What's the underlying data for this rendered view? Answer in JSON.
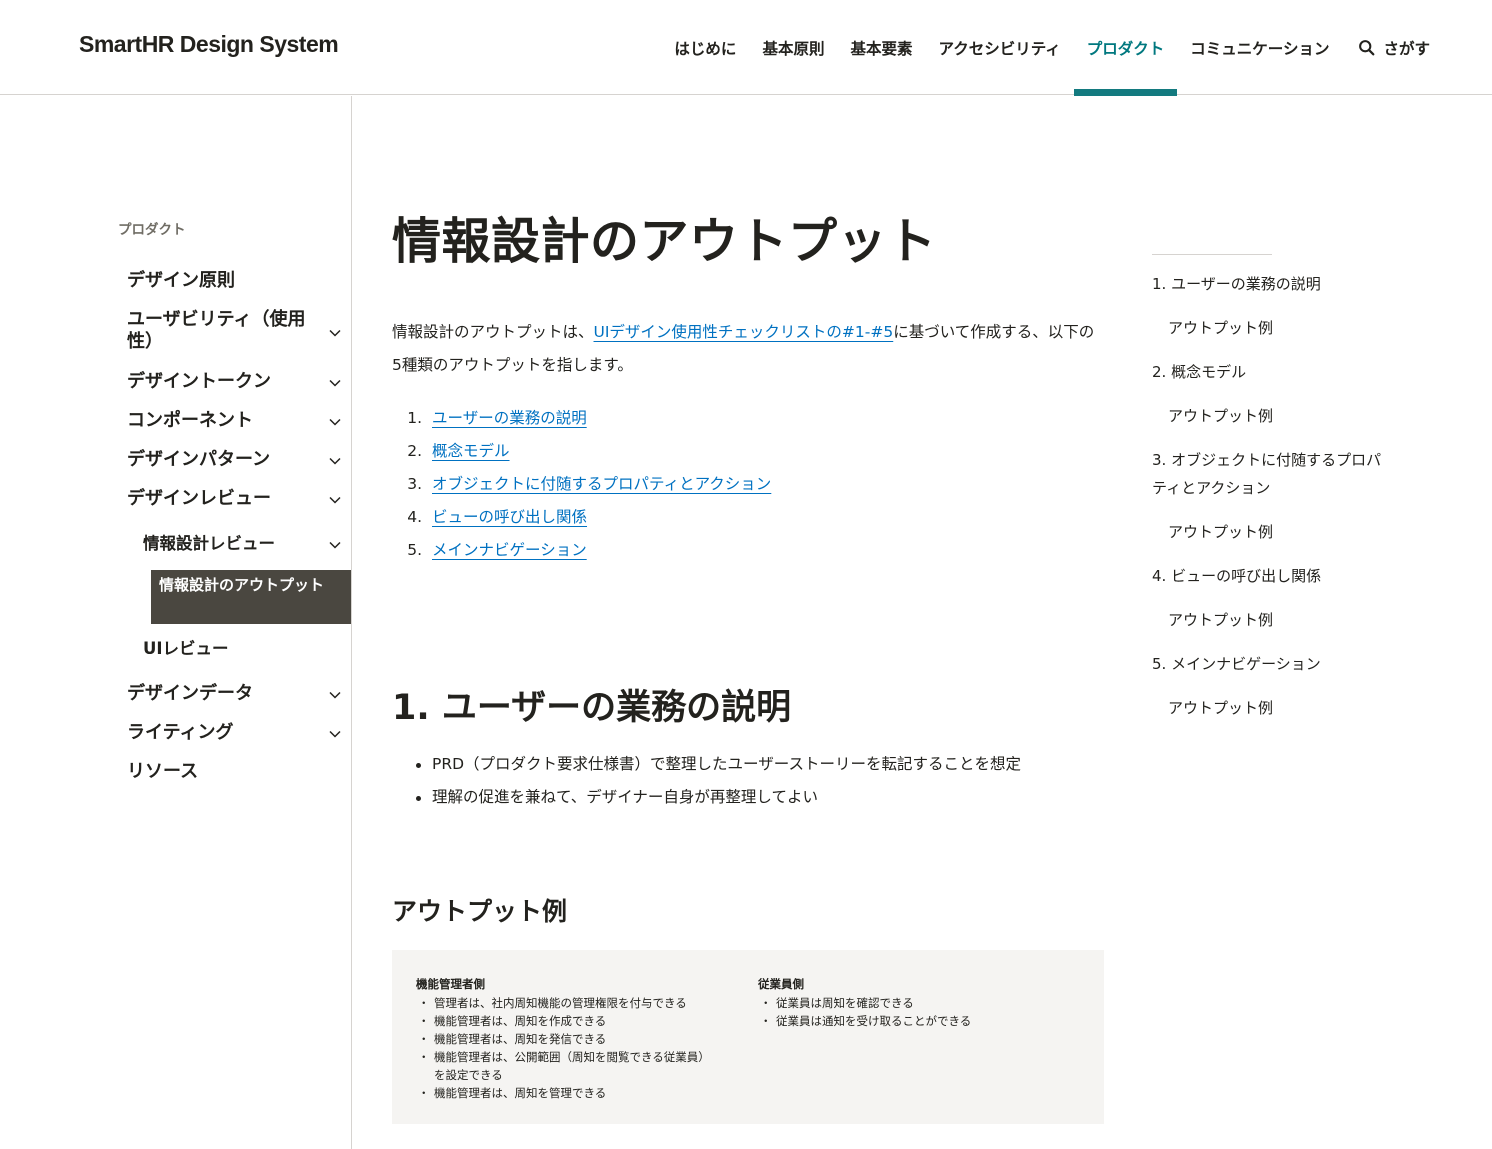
{
  "header": {
    "logo": "SmartHR Design System",
    "nav": [
      {
        "label": "はじめに"
      },
      {
        "label": "基本原則"
      },
      {
        "label": "基本要素"
      },
      {
        "label": "アクセシビリティ"
      },
      {
        "label": "プロダクト",
        "active": true
      },
      {
        "label": "コミュニケーション"
      }
    ],
    "search_label": "さがす"
  },
  "sidebar": {
    "category": "プロダクト",
    "items": [
      {
        "label": "デザイン原則"
      },
      {
        "label": "ユーザビリティ（使用性）"
      },
      {
        "label": "デザイントークン"
      },
      {
        "label": "コンポーネント"
      },
      {
        "label": "デザインパターン"
      },
      {
        "label": "デザインレビュー"
      },
      {
        "label": "情報設計レビュー"
      },
      {
        "label": "情報設計のアウトプット"
      },
      {
        "label": "UIレビュー"
      },
      {
        "label": "デザインデータ"
      },
      {
        "label": "ライティング"
      },
      {
        "label": "リソース"
      }
    ]
  },
  "main": {
    "title": "情報設計のアウトプット",
    "intro_before": "情報設計のアウトプットは、",
    "intro_link": "UIデザイン使用性チェックリストの#1-#5",
    "intro_after": "に基づいて作成する、以下の5種類のアウトプットを指します。",
    "toc": [
      {
        "num": "1.",
        "label": "ユーザーの業務の説明"
      },
      {
        "num": "2.",
        "label": "概念モデル"
      },
      {
        "num": "3.",
        "label": "オブジェクトに付随するプロパティとアクション"
      },
      {
        "num": "4.",
        "label": "ビューの呼び出し関係"
      },
      {
        "num": "5.",
        "label": "メインナビゲーション"
      }
    ],
    "section1_heading": "1. ユーザーの業務の説明",
    "section1_bullets": [
      "PRD（プロダクト要求仕様書）で整理したユーザーストーリーを転記することを想定",
      "理解の促進を兼ねて、デザイナー自身が再整理してよい"
    ],
    "example_heading": "アウトプット例",
    "example": {
      "left_title": "機能管理者側",
      "left_items": [
        "管理者は、社内周知機能の管理権限を付与できる",
        "機能管理者は、周知を作成できる",
        "機能管理者は、周知を発信できる",
        "機能管理者は、公開範囲（周知を閲覧できる従業員）を設定できる",
        "機能管理者は、周知を管理できる"
      ],
      "right_title": "従業員側",
      "right_items": [
        "従業員は周知を確認できる",
        "従業員は通知を受け取ることができる"
      ]
    }
  },
  "right_toc": [
    {
      "label": "1. ユーザーの業務の説明"
    },
    {
      "label": "アウトプット例"
    },
    {
      "label": "2. 概念モデル"
    },
    {
      "label": "アウトプット例"
    },
    {
      "label": "3. オブジェクトに付随するプロパティとアクション"
    },
    {
      "label": "アウトプット例"
    },
    {
      "label": "4. ビューの呼び出し関係"
    },
    {
      "label": "アウトプット例"
    },
    {
      "label": "5. メインナビゲーション"
    },
    {
      "label": "アウトプット例"
    }
  ],
  "colors": {
    "accent": "#137a7f",
    "link": "#0071c1",
    "text": "#23221e",
    "current_bg": "#4a4740",
    "example_bg": "#f5f4f2"
  }
}
